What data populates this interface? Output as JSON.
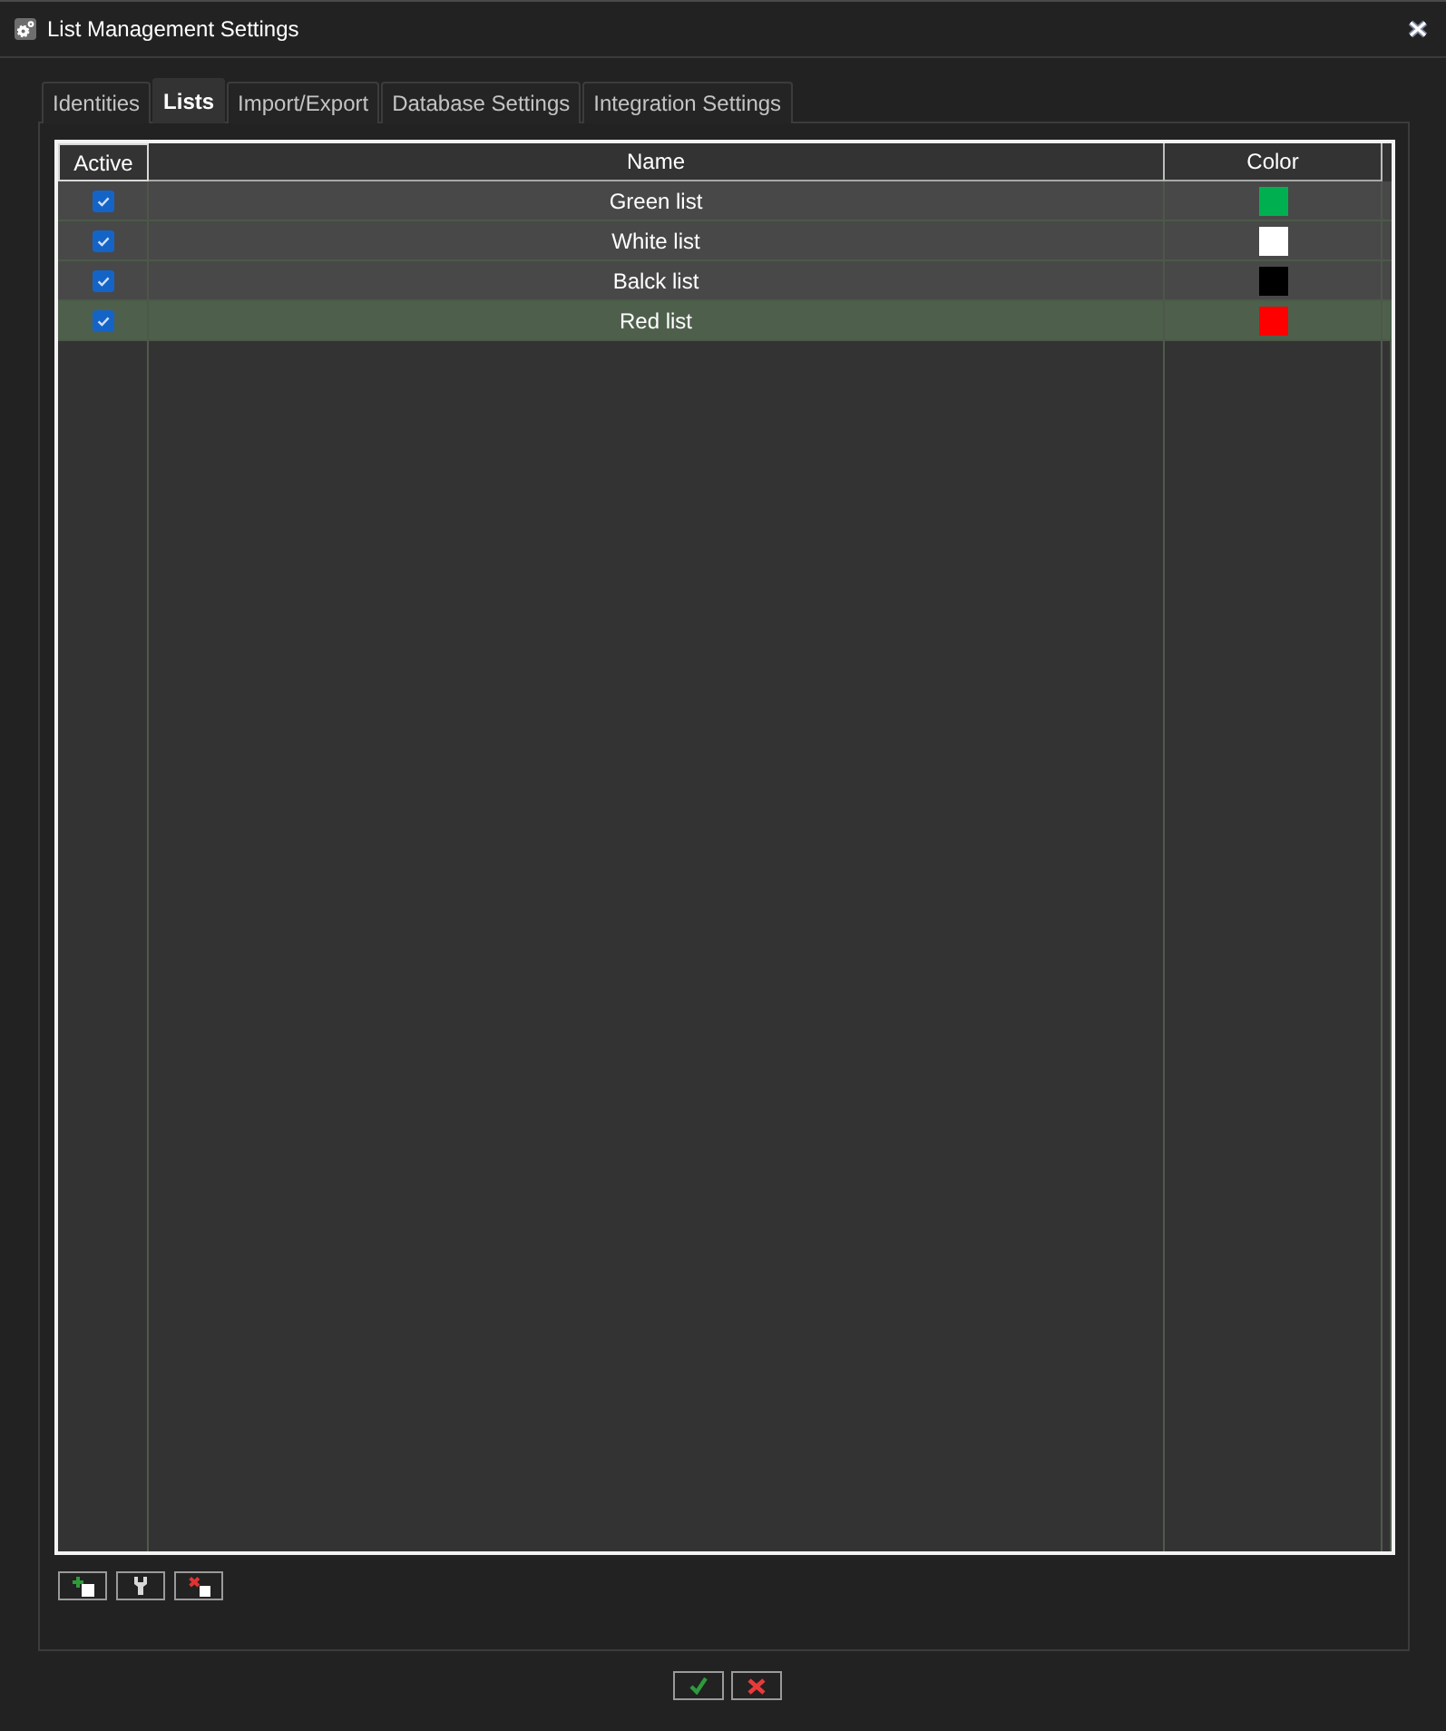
{
  "window": {
    "title": "List Management Settings"
  },
  "tabs": [
    {
      "label": "Identities",
      "selected": false
    },
    {
      "label": "Lists",
      "selected": true
    },
    {
      "label": "Import/Export",
      "selected": false
    },
    {
      "label": "Database Settings",
      "selected": false
    },
    {
      "label": "Integration Settings",
      "selected": false
    }
  ],
  "table": {
    "columns": [
      "Active",
      "Name",
      "Color"
    ],
    "rows": [
      {
        "active": true,
        "name": "Green list",
        "color": "#00b050",
        "selected": false
      },
      {
        "active": true,
        "name": "White list",
        "color": "#ffffff",
        "selected": false
      },
      {
        "active": true,
        "name": "Balck list",
        "color": "#000000",
        "selected": false
      },
      {
        "active": true,
        "name": "Red list",
        "color": "#ff0000",
        "selected": true
      }
    ]
  },
  "list_buttons": [
    {
      "kind": "add"
    },
    {
      "kind": "edit"
    },
    {
      "kind": "delete"
    }
  ],
  "dialog_buttons": [
    {
      "kind": "ok"
    },
    {
      "kind": "cancel"
    }
  ]
}
